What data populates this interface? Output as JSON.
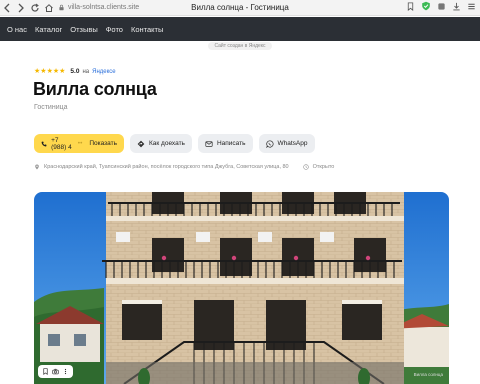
{
  "browser": {
    "url": "villa-solntsa.clients.site",
    "tab_title": "Вилла солнца - Гостиница"
  },
  "nav": {
    "items": [
      "О нас",
      "Каталог",
      "Отзывы",
      "Фото",
      "Контакты"
    ]
  },
  "credit": "Сайт создан в Яндекс",
  "rating": {
    "value": "5.0",
    "on": "на",
    "source": "Яндексе",
    "stars": 5,
    "star_color": "#f5b800"
  },
  "title": "Вилла солнца",
  "subtitle": "Гостиница",
  "buttons": {
    "phone_prefix": "+7 (988) 4",
    "phone_fade": "••",
    "phone_show": "Показать",
    "route": "Как доехать",
    "write": "Написать",
    "whatsapp": "WhatsApp"
  },
  "address": {
    "text": "Краснодарский край, Туапсинский район, посёлок городского типа Джубга, Советская улица, 80",
    "status": "Открыто"
  },
  "photo": {
    "watermark": "Вилла солнца"
  },
  "colors": {
    "nav_bg": "#2b2f35",
    "accent_yellow": "#ffd84d",
    "link_blue": "#2a6fdb"
  }
}
